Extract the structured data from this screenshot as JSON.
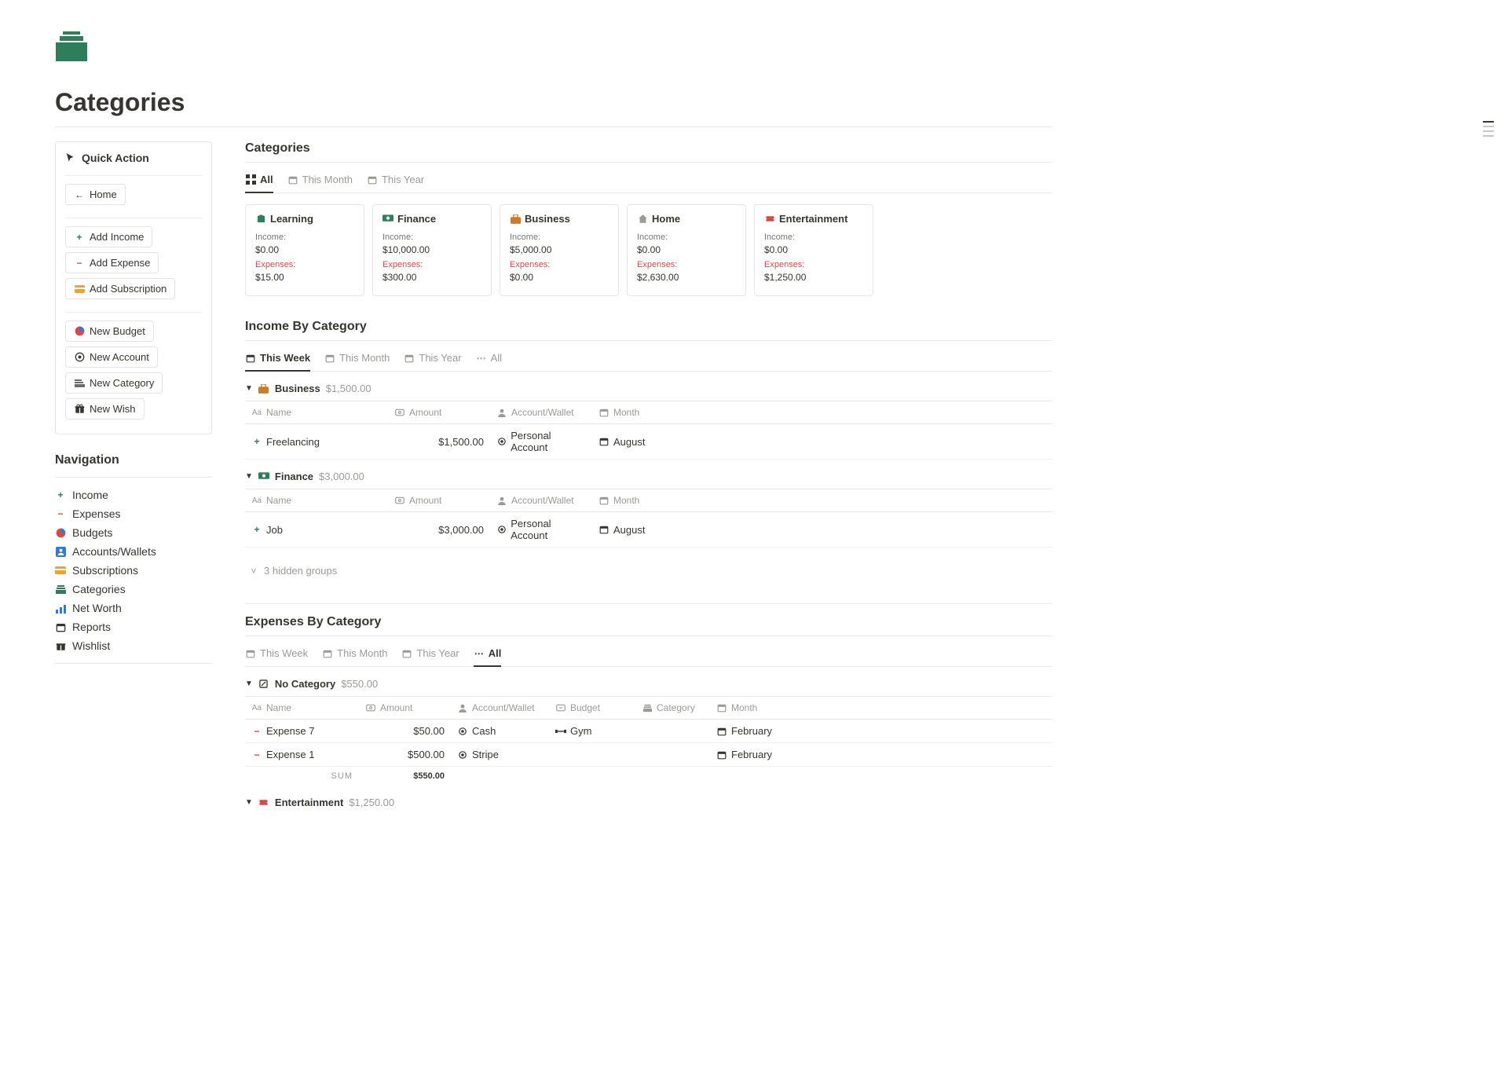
{
  "title": "Categories",
  "quick_action": {
    "header": "Quick Action",
    "home": "Home",
    "add_income": "Add Income",
    "add_expense": "Add Expense",
    "add_subscription": "Add Subscription",
    "new_budget": "New Budget",
    "new_account": "New Account",
    "new_category": "New Category",
    "new_wish": "New Wish"
  },
  "navigation": {
    "header": "Navigation",
    "items": {
      "income": "Income",
      "expenses": "Expenses",
      "budgets": "Budgets",
      "accounts": "Accounts/Wallets",
      "subscriptions": "Subscriptions",
      "categories": "Categories",
      "networth": "Net Worth",
      "reports": "Reports",
      "wishlist": "Wishlist"
    }
  },
  "categories": {
    "title": "Categories",
    "tabs": {
      "all": "All",
      "month": "This Month",
      "year": "This Year"
    },
    "labels": {
      "income": "Income:",
      "expenses": "Expenses:"
    },
    "cards": [
      {
        "name": "Learning",
        "income": "$0.00",
        "expenses": "$15.00"
      },
      {
        "name": "Finance",
        "income": "$10,000.00",
        "expenses": "$300.00"
      },
      {
        "name": "Business",
        "income": "$5,000.00",
        "expenses": "$0.00"
      },
      {
        "name": "Home",
        "income": "$0.00",
        "expenses": "$2,630.00"
      },
      {
        "name": "Entertainment",
        "income": "$0.00",
        "expenses": "$1,250.00"
      }
    ]
  },
  "income_section": {
    "title": "Income By Category",
    "tabs": {
      "week": "This Week",
      "month": "This Month",
      "year": "This Year",
      "all": "All"
    },
    "columns": {
      "name": "Name",
      "amount": "Amount",
      "account": "Account/Wallet",
      "month": "Month"
    },
    "groups": [
      {
        "name": "Business",
        "total": "$1,500.00",
        "rows": [
          {
            "name": "Freelancing",
            "amount": "$1,500.00",
            "account": "Personal Account",
            "month": "August"
          }
        ]
      },
      {
        "name": "Finance",
        "total": "$3,000.00",
        "rows": [
          {
            "name": "Job",
            "amount": "$3,000.00",
            "account": "Personal Account",
            "month": "August"
          }
        ]
      }
    ],
    "hidden_groups": "3 hidden groups"
  },
  "expenses_section": {
    "title": "Expenses By Category",
    "tabs": {
      "week": "This Week",
      "month": "This Month",
      "year": "This Year",
      "all": "All"
    },
    "columns": {
      "name": "Name",
      "amount": "Amount",
      "account": "Account/Wallet",
      "budget": "Budget",
      "category": "Category",
      "month": "Month"
    },
    "groups": [
      {
        "name": "No Category",
        "total": "$550.00",
        "rows": [
          {
            "name": "Expense 7",
            "amount": "$50.00",
            "account": "Cash",
            "budget": "Gym",
            "category": "",
            "month": "February"
          },
          {
            "name": "Expense 1",
            "amount": "$500.00",
            "account": "Stripe",
            "budget": "",
            "category": "",
            "month": "February"
          }
        ],
        "sum_label": "SUM",
        "sum_value": "$550.00"
      }
    ],
    "footer_group": {
      "name": "Entertainment",
      "total": "$1,250.00"
    }
  }
}
